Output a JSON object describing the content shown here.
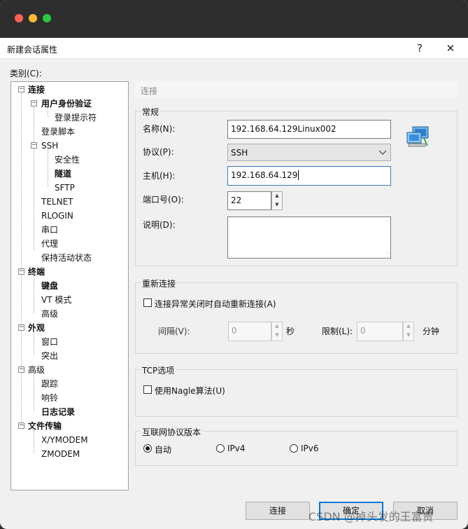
{
  "window": {
    "title": "新建会话属性",
    "help": "?",
    "close": "✕"
  },
  "category_label": "类别(C):",
  "tree": {
    "connection": "连接",
    "user_auth": "用户身份验证",
    "login_prompt": "登录提示符",
    "login_script": "登录脚本",
    "ssh": "SSH",
    "security": "安全性",
    "tunnel": "隧道",
    "sftp": "SFTP",
    "telnet": "TELNET",
    "rlogin": "RLOGIN",
    "serial": "串口",
    "proxy": "代理",
    "keepalive": "保持活动状态",
    "terminal": "终端",
    "keyboard": "键盘",
    "vt_mode": "VT 模式",
    "advanced": "高级",
    "appearance": "外观",
    "window": "窗口",
    "highlight": "突出",
    "advanced2": "高级",
    "trace": "跟踪",
    "bell": "响铃",
    "logging": "日志记录",
    "file_transfer": "文件传输",
    "xymodem": "X/YMODEM",
    "zmodem": "ZMODEM"
  },
  "header": "连接",
  "general": {
    "title": "常规",
    "name_label": "名称(N):",
    "name_value": "192.168.64.129Linux002",
    "protocol_label": "协议(P):",
    "protocol_value": "SSH",
    "host_label": "主机(H):",
    "host_value": "192.168.64.129",
    "port_label": "端口号(O):",
    "port_value": "22",
    "desc_label": "说明(D):"
  },
  "reconnect": {
    "title": "重新连接",
    "checkbox": "连接异常关闭时自动重新连接(A)",
    "interval_label": "间隔(V):",
    "interval_value": "0",
    "sec": "秒",
    "limit_label": "限制(L):",
    "limit_value": "0",
    "min": "分钟"
  },
  "tcp": {
    "title": "TCP选项",
    "nagle": "使用Nagle算法(U)"
  },
  "ipver": {
    "title": "互联网协议版本",
    "auto": "自动",
    "ipv4": "IPv4",
    "ipv6": "IPv6"
  },
  "buttons": {
    "connect": "连接",
    "ok": "确定",
    "cancel": "取消"
  },
  "watermark": "CSDN @掉头发的王富贵",
  "colors": {
    "traffic_red": "#fe5f57",
    "traffic_yellow": "#febc2e",
    "traffic_green": "#28c840",
    "focus_blue": "#0078d7"
  }
}
